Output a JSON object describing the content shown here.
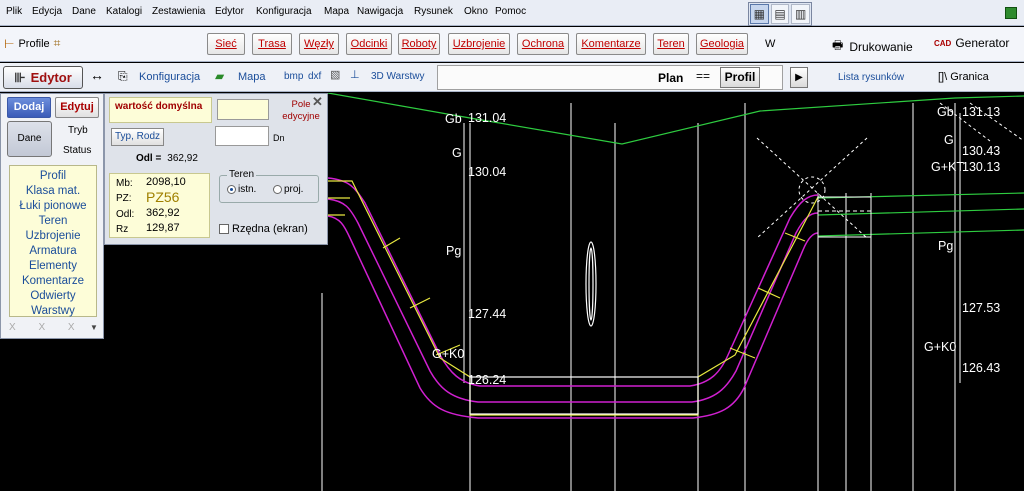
{
  "menu": [
    "Plik",
    "Edycja",
    "Dane",
    "Katalogi",
    "Zestawienia",
    "Edytor",
    "Konfiguracja",
    "Mapa",
    "Nawigacja",
    "Rysunek",
    "Okno",
    "Pomoc"
  ],
  "toolbar2": {
    "profile_label": "Profile",
    "buttons": [
      "Sieć",
      "Trasa",
      "Węzły",
      "Odcinki",
      "Roboty",
      "Uzbrojenie",
      "Ochrona",
      "Komentarze",
      "Teren",
      "Geologia"
    ],
    "w_label": "W",
    "print_label": "Drukowanie",
    "generator_label": "Generator",
    "cad_label": "CAD"
  },
  "toolbar3": {
    "editor_label": "Edytor",
    "konfig_label": "Konfiguracja",
    "mapa_label": "Mapa",
    "bmp_label": "bmp",
    "dxf_label": "dxf",
    "warstwy_label": "3D Warstwy",
    "plan_label": "Plan",
    "eq_label": "==",
    "profil_label": "Profil",
    "arrow_label": "▶",
    "lista_label": "Lista rysunków",
    "granica_label": "[]\\  Granica"
  },
  "left_panel": {
    "dodaj": "Dodaj",
    "edytuj": "Edytuj",
    "dane": "Dane",
    "tryb": "Tryb",
    "status": "Status",
    "items": [
      "Profil",
      "Klasa mat.",
      "Łuki pionowe",
      "Teren",
      "Uzbrojenie",
      "Armatura",
      "Elementy",
      "Komentarze",
      "Odwierty",
      "Warstwy"
    ],
    "bottom_marks": "X X X"
  },
  "float_panel": {
    "default_label": "wartość domyślna",
    "pole_label": "Pole edycyjne",
    "typ_label": "Typ, Rodz",
    "dn_label": "Dn",
    "odl_label": "Odl =",
    "odl_value": "362,92",
    "values": [
      {
        "key": "Mb:",
        "val": "2098,10"
      },
      {
        "key": "PZ:",
        "val": "PZ56"
      },
      {
        "key": "Odl:",
        "val": "362,92"
      },
      {
        "key": "Rz",
        "val": "129,87"
      }
    ],
    "teren_label": "Teren",
    "istn_label": "istn.",
    "proj_label": "proj.",
    "rzedna_label": "Rzędna (ekran)",
    "close": "✕"
  },
  "drawing_labels": {
    "left": {
      "gb": "Gb",
      "gb_val": "131.04",
      "g": "G",
      "g_val": "130.04",
      "pg": "Pg",
      "v127": "127.44",
      "gk0": "G+K0",
      "v126": "126.24"
    },
    "right": {
      "gb": "Gb",
      "gb_val": "131.13",
      "g": "G",
      "g_val": "130.43",
      "gkt": "G+KT",
      "gkt_val": "130.13",
      "pg": "Pg",
      "v127": "127.53",
      "gk0": "G+K0",
      "v126": "126.43"
    }
  },
  "colors": {
    "ground_line": "#2ecc40",
    "pipe_magenta": "#d020d0",
    "yellow": "#e8e840",
    "white": "#ffffff"
  }
}
